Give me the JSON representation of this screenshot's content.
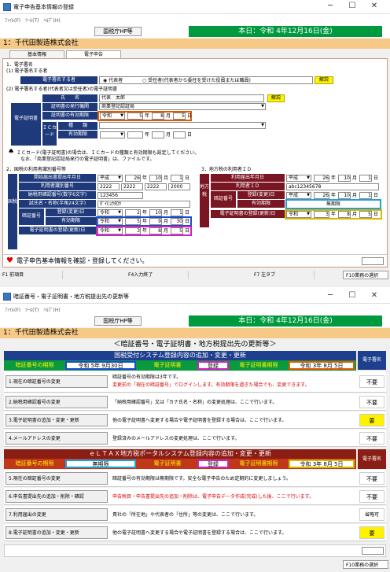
{
  "w1": {
    "title": "電子申告基本情報の登録",
    "menu": [
      "ﾌｧｲﾙ(F)",
      "ﾂｰﾙ(T)",
      "ﾍﾙﾌﾟ(H)"
    ],
    "hp": "国税庁HP等",
    "date": "本日：令和 4年12月16日(金)",
    "org": "1：千代田製造株式会社",
    "tabs": [
      "基本情報",
      "電子申告"
    ],
    "s1": "1．電子署名",
    "s1a": "(1) 電子署名する者",
    "signer_label": "電子署名する者",
    "radio1": "代表者",
    "radio2": "受任者(代表者から委任を受けた役員または職員)",
    "explain": "解説",
    "s1b": "(2) 電子署名する者(代表者又は受任者)の電子証明書",
    "name_label": "氏　　名",
    "name_val": "代表　太郎",
    "cert_label": "電子証明書",
    "cert_type_label": "証明書の発行機関",
    "cert_type_val": "商業登記認証局",
    "expiry_label": "証明書の有効期限",
    "era": "令和",
    "exp": [
      "5",
      "8",
      "5"
    ],
    "ic_label": "ＩＣカード",
    "kind_label": "種　　類",
    "ic_exp_label": "有効期限",
    "u_nen": "年",
    "u_tsuki": "月",
    "u_hi": "日",
    "note1": "ＩＣカード(電子証明書)の場合は、ＩＣカードの種類と有効期限も設定してください。",
    "note2": "なお、「商業登記認証局発行の電子証明書」は、ファイルです。",
    "s2": "2．国税の利用者識別番号等",
    "s3": "3．地方税の利用者ＩＤ",
    "kokuzei": "国税",
    "chihou": "地方税",
    "k_start_label": "開始届出書提出年月日",
    "heisei": "平成",
    "k_start": [
      "26",
      "10",
      "1"
    ],
    "k_id_label": "利用者識別番号",
    "k_id": [
      "2222",
      "2222",
      "2222",
      "2000"
    ],
    "k_corp_label": "納税用確認番号(数字6文字)",
    "k_corp": "123456",
    "k_kana_label": "試氏名・名称(半角24文字)",
    "k_kana": "ﾀﾞｲﾋｮｳﾀﾛｳ",
    "pin_label": "暗証番号",
    "pin_reg_label": "登録(変更)日",
    "pin_reg": [
      "2",
      "10",
      "1"
    ],
    "pin_exp_label": "有効期限",
    "pin_exp": [
      "5",
      "9",
      "30"
    ],
    "k_cert_reg_label": "電子証明書の登録(更新)日",
    "k_cert_reg": [
      "3",
      "8",
      "5"
    ],
    "l_start_label": "利用届出年月日",
    "l_start": [
      "26",
      "10",
      "1"
    ],
    "l_id_label": "利用者ＩＤ",
    "l_id": "abc12345678",
    "l_pin_reg": [
      "26",
      "10",
      "1"
    ],
    "l_pin_exp_val": "無期限",
    "l_cert_reg": [
      "3",
      "8",
      "5"
    ],
    "status_msg": "電子申告基本情報を確認・登録してください。",
    "fkeys": [
      "F1 前項目",
      "F4入力終了",
      "F7 左タブ",
      "F10業務の選択"
    ]
  },
  "w2": {
    "title": "暗証番号・電子証明書・地方税提出先の更新等",
    "menu": [
      "ﾌｧｲﾙ(F)",
      "ﾂｰﾙ(T)",
      "ﾍﾙﾌﾟ(H)"
    ],
    "hp": "国税庁HP等",
    "date": "本日：令和 4年12月16日(金)",
    "org": "1：千代田製造株式会社",
    "heading": "＜暗証番号・電子証明書・地方税提出先の更新等＞",
    "nat_header": "国税受付システム登録内容の追加・変更・更新",
    "ecert_col": "電子署名",
    "pin_exp_label": "暗証番号の期限",
    "pin_exp_val": "令和 5年 9月30日",
    "cert_label": "電子証明書",
    "registered": "登録",
    "cert_exp_label": "電子証明書期限",
    "cert_exp_val": "令和 3年 8月 5日",
    "rows1": [
      {
        "btn": "1.現在の暗証番号の変更",
        "desc1": "暗証番号の有効期限は3年です。",
        "desc2": "変更前の「現在の暗証番号」でログインします。有効期限を過ぎた場合でも、変更できます。",
        "st": "不要"
      },
      {
        "btn": "2.納税用確認番号の変更",
        "desc1": "「納税用確認番号」又は「カナ氏名・名称」の変更処理は、ここで行います。",
        "st": "不要"
      },
      {
        "btn": "3.電子証明書の追加・変更・更新",
        "desc1": "他の電子証明書へ変更する場合や電子証明書を登録する場合は、ここで行います。",
        "st": "要"
      },
      {
        "btn": "4.メールアドレスの変更",
        "desc1": "登録済みのメールアドレスの変更処理は、ここで行います。",
        "st": "不要"
      }
    ],
    "loc_header": "ｅＬＴＡＸ地方税ポータルシステム登録内容の追加・変更・更新",
    "l_pin_exp_val": "無期限",
    "l_cert_exp_val": "令和 3年 8月 5日",
    "rows2": [
      {
        "btn": "5.現在の暗証番号の変更",
        "desc1": "暗証番号の有効期限は無期限です。安全な電子申告のため定期的に変更しましょう。",
        "st": "不要"
      },
      {
        "btn": "6.申告書提出先の追加・削除・確認",
        "desc1": "申告税目・申告書提出先の追加・削除は、電子申告データ作成(完成)した後、ここで行います。",
        "st": "不要"
      },
      {
        "btn": "7.利用届出の変更",
        "desc1": "貴社の「所在地」や代表者の「住所」等の変更は、ここで行います。",
        "st": "省略可"
      },
      {
        "btn": "8.電子証明書の追加・変更・更新",
        "desc1": "他の電子証明書へ変更する場合や電子証明書を登録する場合は、ここで行います。",
        "st": "要"
      }
    ],
    "f10": "F10業務の選択"
  }
}
